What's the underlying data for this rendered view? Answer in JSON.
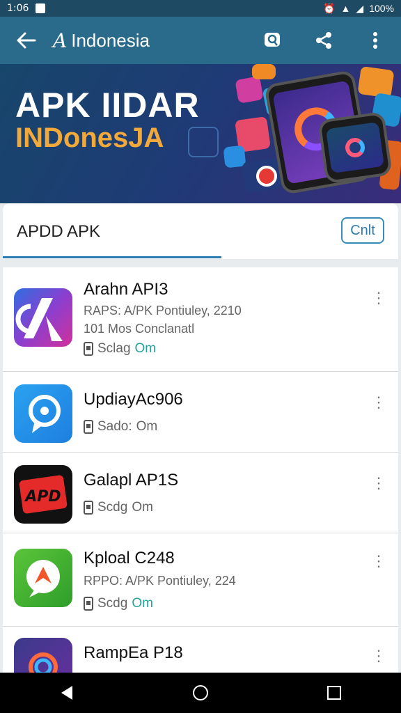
{
  "status": {
    "time": "1:06",
    "battery": "100%"
  },
  "appbar": {
    "back_icon": "arrow-left-icon",
    "logo_glyph": "A",
    "title": "Indonesia",
    "actions": [
      "search-icon",
      "share-icon",
      "more-vert-icon"
    ]
  },
  "hero": {
    "line1": "APK IIDAR",
    "line2": "INDonesJA"
  },
  "tabs": {
    "active": "APDD APK",
    "chip": "Cnlt"
  },
  "items": [
    {
      "name": "Arahn API3",
      "line1": "RAPS: A/PK Pontiuley, 2210",
      "line2": "101 Mos Conclanatl",
      "meta_label": "Sclag",
      "meta_value": "Om",
      "meta_teal": true
    },
    {
      "name": "UpdiayAc906",
      "meta_label": "Sado:",
      "meta_value": "Om",
      "meta_teal": false
    },
    {
      "name": "Galapl AP1S",
      "meta_label": "Scdg",
      "meta_value": "Om",
      "meta_teal": false
    },
    {
      "name": "Kploal C248",
      "line1": "RPPO: A/PK Pontiuley, 224",
      "meta_label": "Scdg",
      "meta_value": "Om",
      "meta_teal": true
    },
    {
      "name": "RampEa P18",
      "meta_label": "",
      "meta_value": "",
      "meta_teal": false
    }
  ],
  "colors": {
    "appbar": "#2a6a8a",
    "accent": "#2a7bb2",
    "teal": "#26a39a"
  }
}
